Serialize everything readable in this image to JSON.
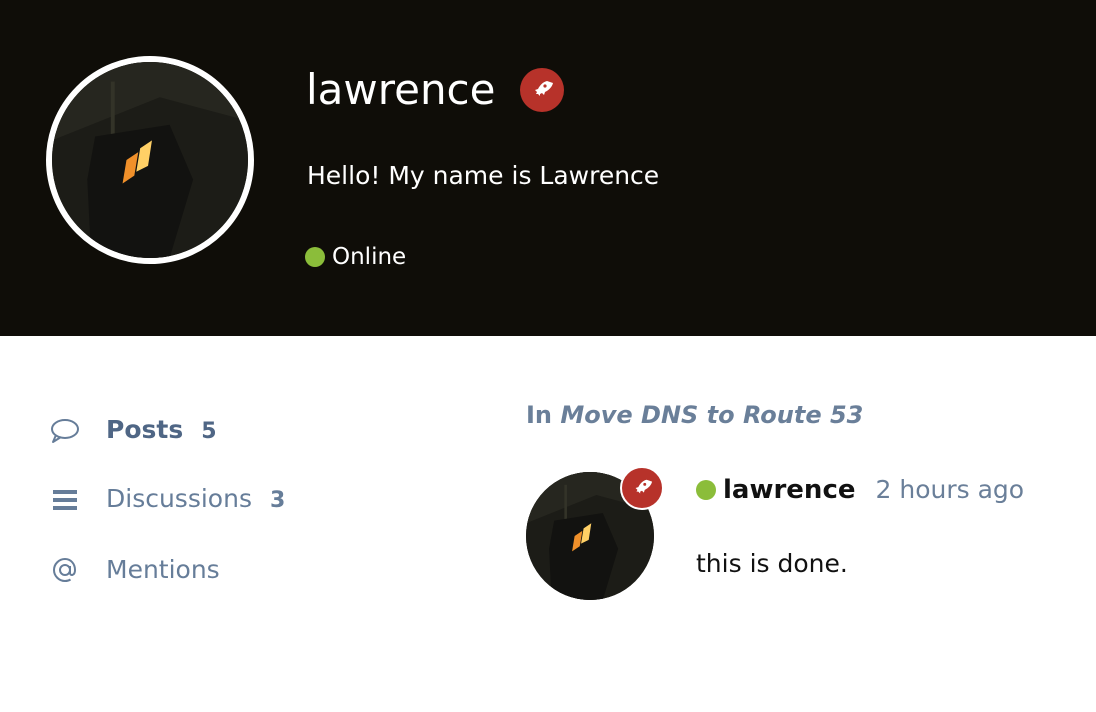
{
  "profile": {
    "username": "lawrence",
    "bio": "Hello! My name is Lawrence",
    "status": "Online",
    "avatar_icon": "user-avatar-photo",
    "badge_icon": "rocket-icon"
  },
  "colors": {
    "hero_background": "#0f0d08",
    "badge": "#b7322a",
    "online": "#8bbd3a",
    "muted_text": "#667d99"
  },
  "nav": {
    "items": [
      {
        "icon": "speech-bubble-icon",
        "label": "Posts",
        "count": "5",
        "active": true
      },
      {
        "icon": "list-icon",
        "label": "Discussions",
        "count": "3",
        "active": false
      },
      {
        "icon": "at-sign-icon",
        "label": "Mentions",
        "count": "",
        "active": false
      }
    ]
  },
  "post": {
    "context_prefix": "In",
    "discussion_title": "Move DNS to Route 53",
    "author": "lawrence",
    "time": "2 hours ago",
    "body": "this is done."
  }
}
